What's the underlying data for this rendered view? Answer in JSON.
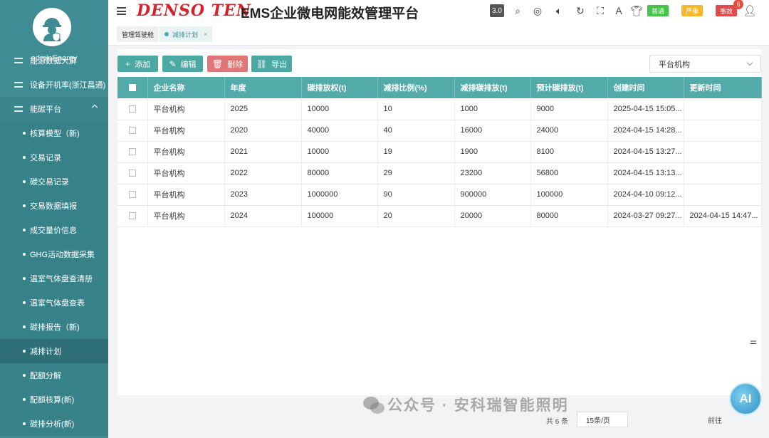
{
  "sidebar": {
    "username": "adminEnergy",
    "items": [
      {
        "label": "能源数据大屏",
        "kind": "top"
      },
      {
        "label": "设备开机率(浙江昌通)",
        "kind": "top"
      },
      {
        "label": "能碳平台",
        "kind": "parent"
      },
      {
        "label": "核算模型（新)",
        "kind": "sub"
      },
      {
        "label": "交易记录",
        "kind": "sub"
      },
      {
        "label": "碳交易记录",
        "kind": "sub"
      },
      {
        "label": "交易数据填报",
        "kind": "sub"
      },
      {
        "label": "成交量价信息",
        "kind": "sub"
      },
      {
        "label": "GHG活动数据采集",
        "kind": "sub"
      },
      {
        "label": "温室气体盘查清册",
        "kind": "sub"
      },
      {
        "label": "温室气体盘查表",
        "kind": "sub"
      },
      {
        "label": "碳排报告（新)",
        "kind": "sub"
      },
      {
        "label": "减排计划",
        "kind": "sub",
        "active": true
      },
      {
        "label": "配额分解",
        "kind": "sub"
      },
      {
        "label": "配额核算(新)",
        "kind": "sub"
      },
      {
        "label": "碳排分析(新)",
        "kind": "sub"
      }
    ]
  },
  "header": {
    "brand": "DENSO TEN",
    "title": "EMS企业微电网能效管理平台",
    "version": "3.0",
    "tags": {
      "normal": "普通",
      "serious": "严重",
      "accident": "事故"
    },
    "badge": "6"
  },
  "tabs": [
    {
      "label": "管理驾驶舱"
    },
    {
      "label": "减排计划",
      "close": "×"
    }
  ],
  "toolbar": {
    "add": "添加",
    "edit": "编辑",
    "delete": "删除",
    "export": "导出"
  },
  "org_select": {
    "value": "平台机构"
  },
  "table": {
    "columns": [
      "企业名称",
      "年度",
      "碳排放权(t)",
      "减排比例(%)",
      "减排碳排放(t)",
      "预计碳排放(t)",
      "创建时间",
      "更新时间"
    ],
    "rows": [
      [
        "平台机构",
        "2025",
        "10000",
        "10",
        "1000",
        "9000",
        "2025-04-15 15:05...",
        ""
      ],
      [
        "平台机构",
        "2020",
        "40000",
        "40",
        "16000",
        "24000",
        "2024-04-15 14:28...",
        ""
      ],
      [
        "平台机构",
        "2021",
        "10000",
        "19",
        "1900",
        "8100",
        "2024-04-15 13:27...",
        ""
      ],
      [
        "平台机构",
        "2022",
        "80000",
        "29",
        "23200",
        "56800",
        "2024-04-15 13:13...",
        ""
      ],
      [
        "平台机构",
        "2023",
        "1000000",
        "90",
        "900000",
        "100000",
        "2024-04-10 09:12...",
        ""
      ],
      [
        "平台机构",
        "2024",
        "100000",
        "20",
        "20000",
        "80000",
        "2024-03-27 09:27...",
        "2024-04-15 14:47..."
      ]
    ]
  },
  "pager": {
    "total": "共 6 条",
    "pagesize": "15条/页",
    "goto": "前往"
  },
  "watermark": {
    "text": "公众号 · 安科瑞智能照明"
  },
  "ai_badge": {
    "text": "AI"
  }
}
